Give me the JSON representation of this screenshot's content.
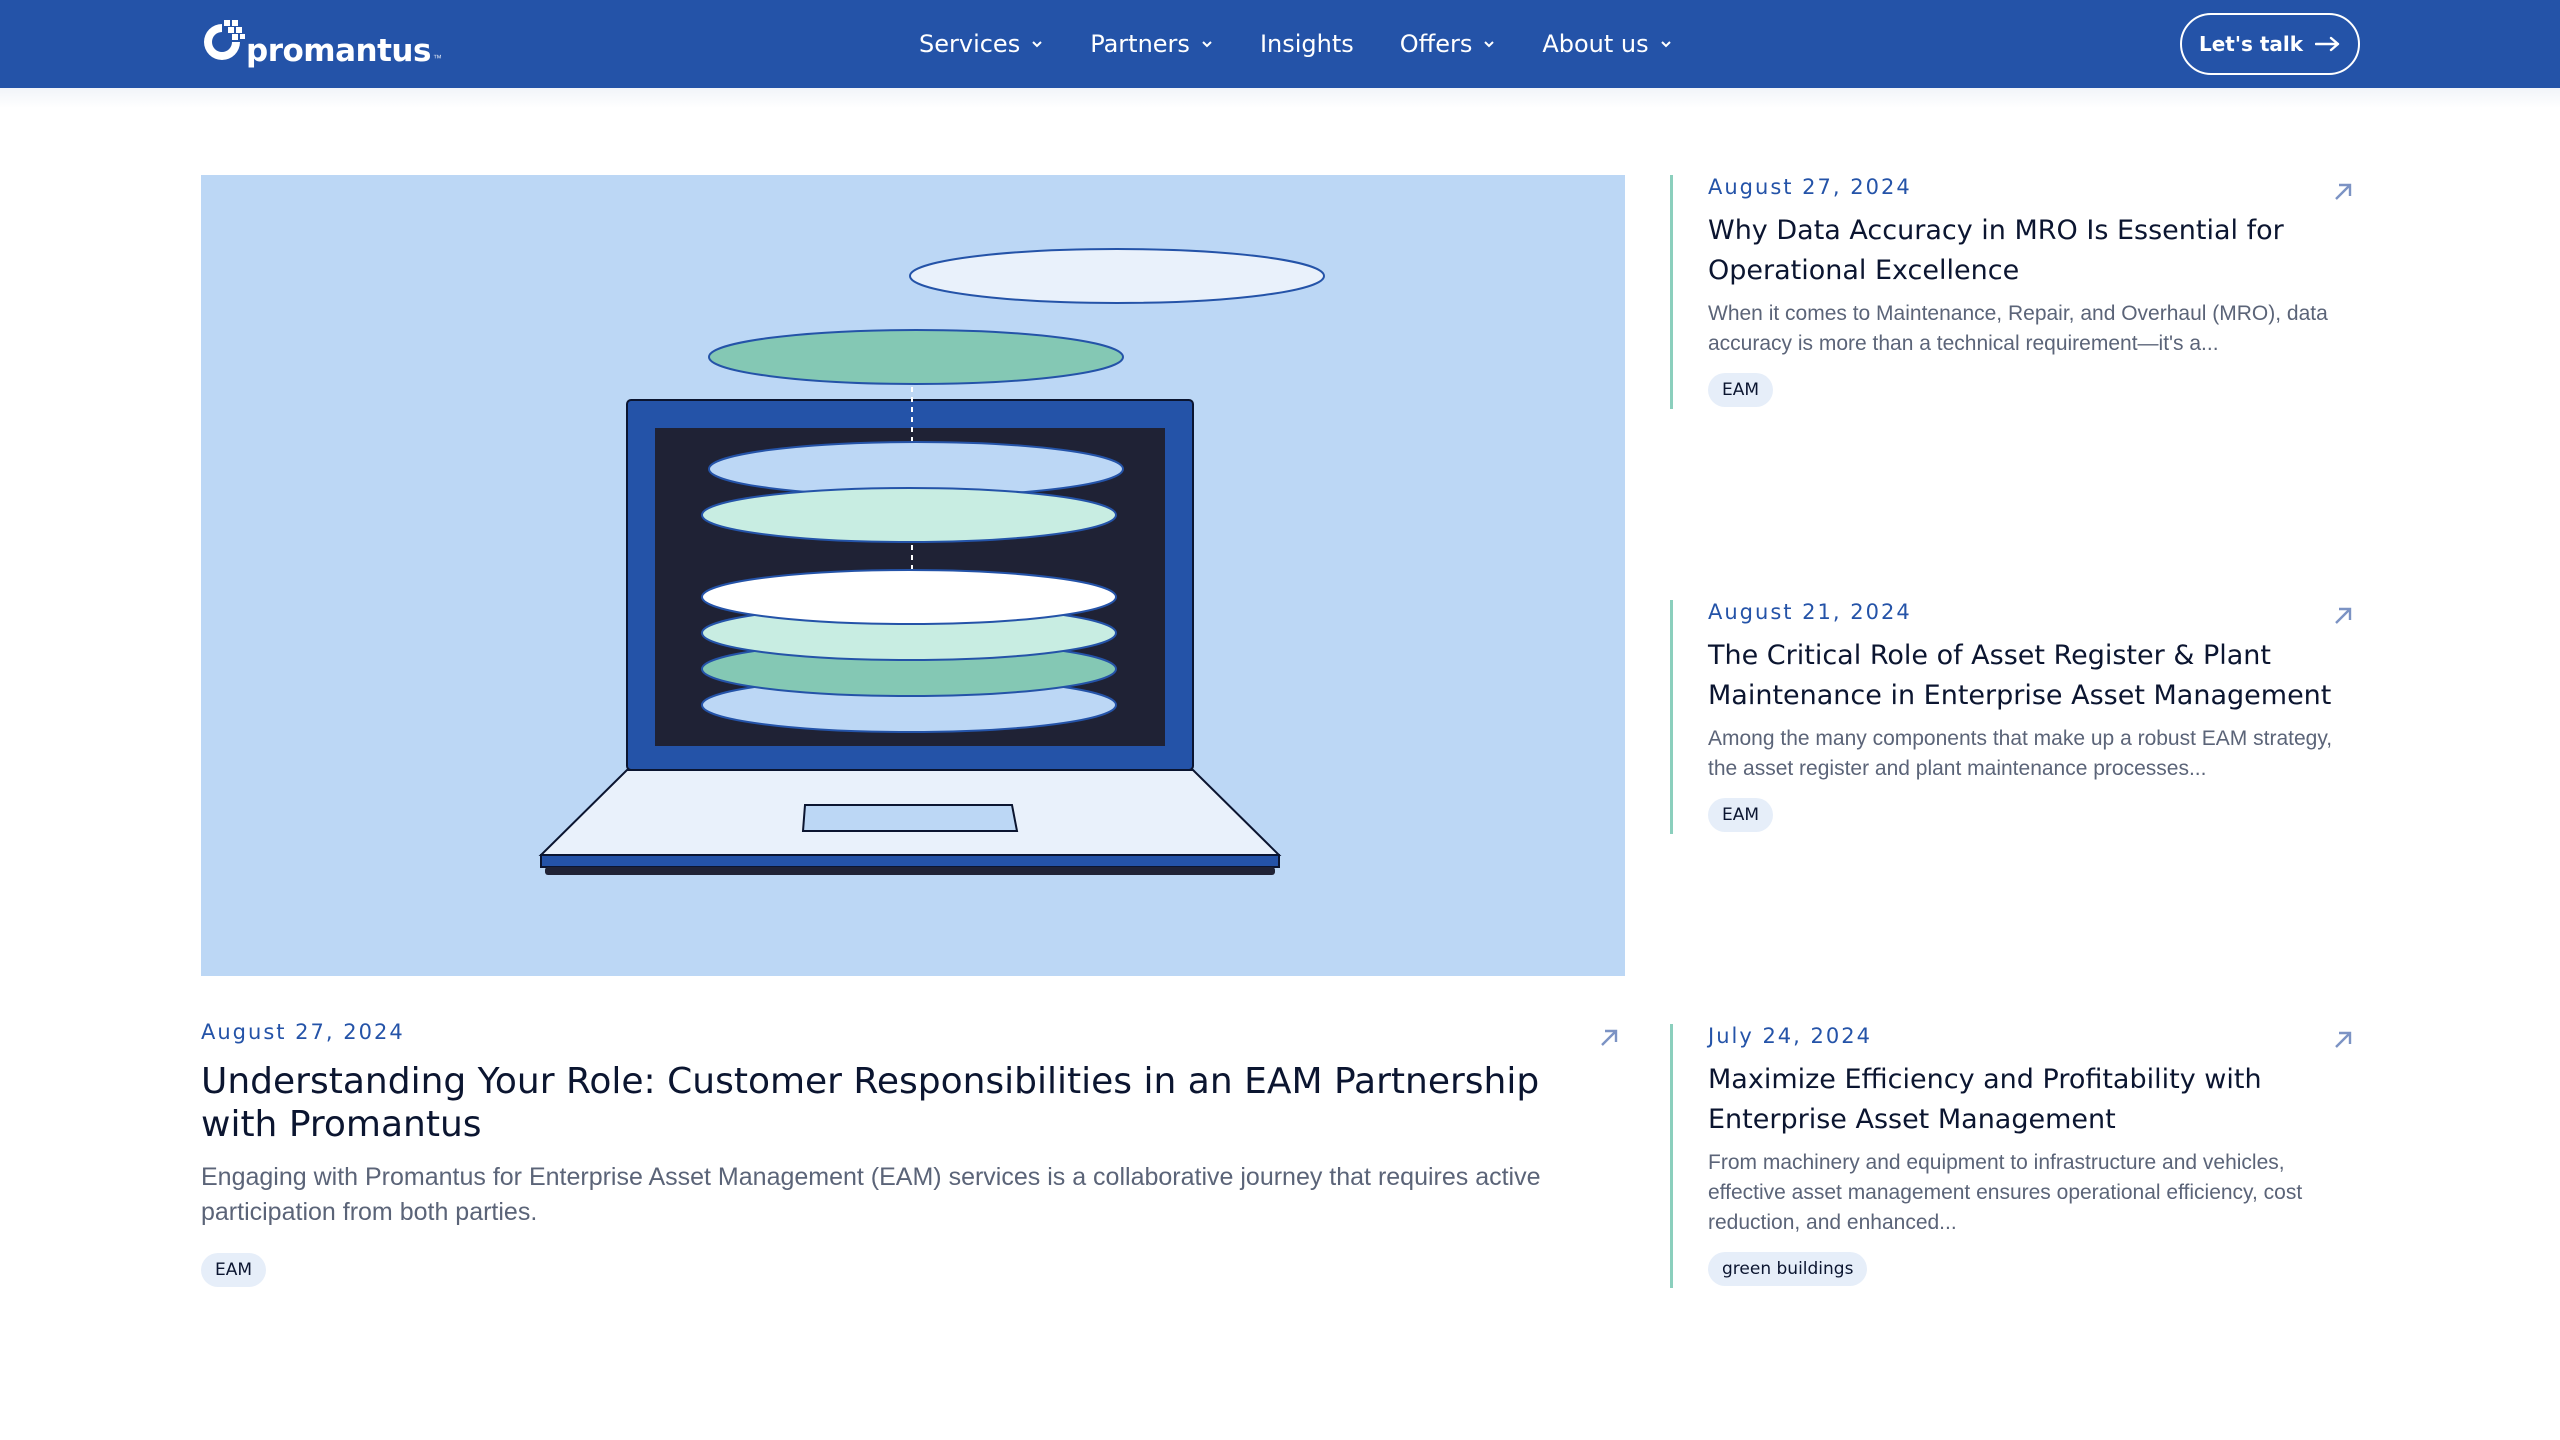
{
  "brand": {
    "name": "promantus",
    "logo_icon": "promantus-logo-icon",
    "color_primary": "#2453a8",
    "color_accent": "#8bcfbd"
  },
  "nav": {
    "items": [
      {
        "label": "Services",
        "has_dropdown": true
      },
      {
        "label": "Partners",
        "has_dropdown": true
      },
      {
        "label": "Insights",
        "has_dropdown": false
      },
      {
        "label": "Offers",
        "has_dropdown": true
      },
      {
        "label": "About us",
        "has_dropdown": true
      }
    ],
    "cta_label": "Let's talk"
  },
  "featured": {
    "date": "August 27, 2024",
    "title": "Understanding Your Role: Customer Responsibilities in an EAM Partnership with Promantus",
    "excerpt": "Engaging with Promantus for Enterprise Asset Management (EAM) services is a collaborative journey that requires active participation from both parties.",
    "tag": "EAM"
  },
  "side_articles": [
    {
      "date": "August 27, 2024",
      "title": "Why Data Accuracy in MRO Is Essential for Operational Excellence",
      "excerpt": "When it comes to Maintenance, Repair, and Overhaul (MRO), data accuracy is more than a technical requirement—it's a...",
      "tag": "EAM"
    },
    {
      "date": "August 21, 2024",
      "title": "The Critical Role of Asset Register & Plant Maintenance in Enterprise Asset Management",
      "excerpt": "Among the many components that make up a robust EAM strategy, the asset register and plant maintenance processes...",
      "tag": "EAM"
    },
    {
      "date": "July 24, 2024",
      "title": "Maximize Efficiency and Profitability with Enterprise Asset Management",
      "excerpt": "From machinery and equipment to infrastructure and vehicles, effective asset management ensures operational efficiency, cost reduction, and enhanced...",
      "tag": "green buildings"
    }
  ]
}
